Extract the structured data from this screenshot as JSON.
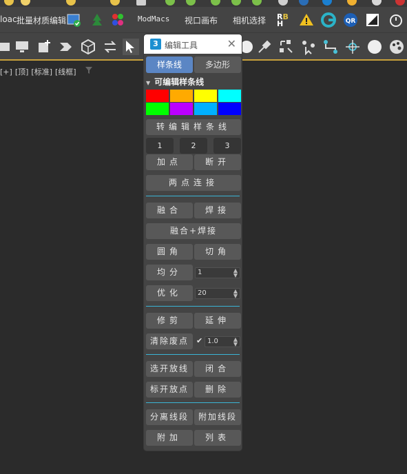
{
  "toolbar_top": {
    "left_text": "loac",
    "batch_material": "批量材质编辑",
    "modmacs": "ModMacs",
    "viewport_canvas": "视口画布",
    "camera_select": "相机选择"
  },
  "viewport_label": {
    "plus": "[+]",
    "view": "[顶]",
    "quality": "[标准]",
    "shading": "[线框]"
  },
  "panel": {
    "app_badge": "3",
    "title": "编辑工具",
    "close": "✕",
    "tabs": [
      "样条线",
      "多边形"
    ],
    "section_title": "可编辑样条线",
    "colors": [
      "#ff0000",
      "#ffaa00",
      "#ffff00",
      "#00ffff",
      "#00ff00",
      "#bb00ff",
      "#00b0ff",
      "#0000ff"
    ],
    "btn_convert": "转编辑样条线",
    "num_buttons": [
      "1",
      "2",
      "3"
    ],
    "btn_add_point": "加点",
    "btn_break": "断开",
    "btn_connect_two": "两点连接",
    "btn_fuse": "融合",
    "btn_weld": "焊接",
    "btn_fuse_weld": "融合+焊接",
    "btn_fillet": "圆角",
    "btn_chamfer": "切角",
    "btn_divide": "均分",
    "divide_value": "1",
    "btn_optimize": "优化",
    "optimize_value": "20",
    "btn_trim": "修剪",
    "btn_extend": "延伸",
    "btn_clear_waste": "清除废点",
    "clear_check": "✔",
    "clear_value": "1.0",
    "btn_select_open": "选开放线",
    "btn_close": "闭合",
    "btn_mark_open": "标开放点",
    "btn_delete": "删除",
    "btn_detach_seg": "分离线段",
    "btn_attach_seg": "附加线段",
    "btn_attach": "附加",
    "btn_list": "列表"
  },
  "icons": {
    "filter": "filter-icon",
    "select": "select-arrow-icon"
  }
}
